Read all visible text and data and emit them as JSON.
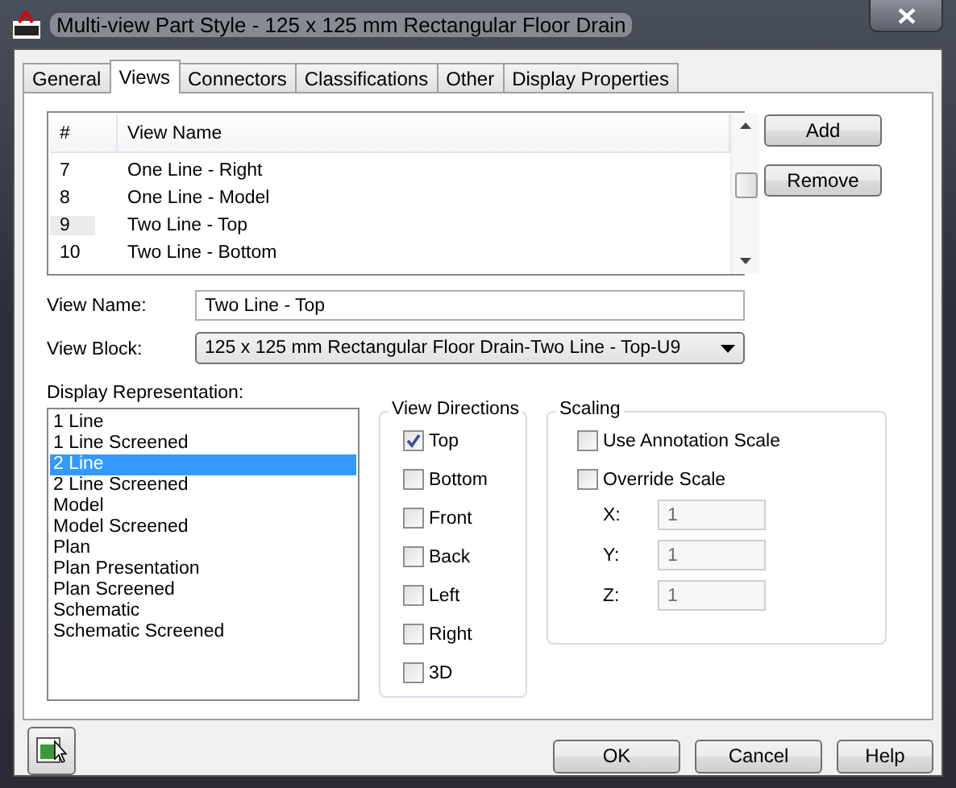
{
  "window": {
    "title": "Multi-view Part Style - 125 x 125 mm Rectangular Floor Drain"
  },
  "tabs": [
    {
      "label": "General",
      "selected": false
    },
    {
      "label": "Views",
      "selected": true
    },
    {
      "label": "Connectors",
      "selected": false
    },
    {
      "label": "Classifications",
      "selected": false
    },
    {
      "label": "Other",
      "selected": false
    },
    {
      "label": "Display Properties",
      "selected": false
    }
  ],
  "views_table": {
    "columns": [
      "#",
      "View Name"
    ],
    "rows": [
      {
        "number": "7",
        "name": "One Line - Right",
        "selected": false
      },
      {
        "number": "8",
        "name": "One Line - Model",
        "selected": false
      },
      {
        "number": "9",
        "name": "Two Line - Top",
        "selected": true
      },
      {
        "number": "10",
        "name": "Two Line - Bottom",
        "selected": false
      }
    ]
  },
  "side_buttons": [
    "Add",
    "Remove"
  ],
  "view_name": {
    "label": "View Name:",
    "value": "Two Line - Top"
  },
  "view_block": {
    "label": "View Block:",
    "value": "125 x 125 mm Rectangular Floor Drain-Two Line - Top-U9"
  },
  "display_representation": {
    "label": "Display Representation:",
    "items": [
      {
        "label": "1 Line",
        "selected": false
      },
      {
        "label": "1 Line Screened",
        "selected": false
      },
      {
        "label": "2 Line",
        "selected": true
      },
      {
        "label": "2 Line Screened",
        "selected": false
      },
      {
        "label": "Model",
        "selected": false
      },
      {
        "label": "Model Screened",
        "selected": false
      },
      {
        "label": "Plan",
        "selected": false
      },
      {
        "label": "Plan Presentation",
        "selected": false
      },
      {
        "label": "Plan Screened",
        "selected": false
      },
      {
        "label": "Schematic",
        "selected": false
      },
      {
        "label": "Schematic Screened",
        "selected": false
      }
    ]
  },
  "view_directions": {
    "title": "View Directions",
    "items": [
      {
        "label": "Top",
        "checked": true
      },
      {
        "label": "Bottom",
        "checked": false
      },
      {
        "label": "Front",
        "checked": false
      },
      {
        "label": "Back",
        "checked": false
      },
      {
        "label": "Left",
        "checked": false
      },
      {
        "label": "Right",
        "checked": false
      },
      {
        "label": "3D",
        "checked": false
      }
    ]
  },
  "scaling": {
    "title": "Scaling",
    "options": [
      {
        "label": "Use Annotation Scale",
        "checked": false
      },
      {
        "label": "Override Scale",
        "checked": false
      }
    ],
    "fields": [
      {
        "label": "X:",
        "value": "1",
        "disabled": true
      },
      {
        "label": "Y:",
        "value": "1",
        "disabled": true
      },
      {
        "label": "Z:",
        "value": "1",
        "disabled": true
      }
    ]
  },
  "footer_buttons": [
    "OK",
    "Cancel",
    "Help"
  ]
}
